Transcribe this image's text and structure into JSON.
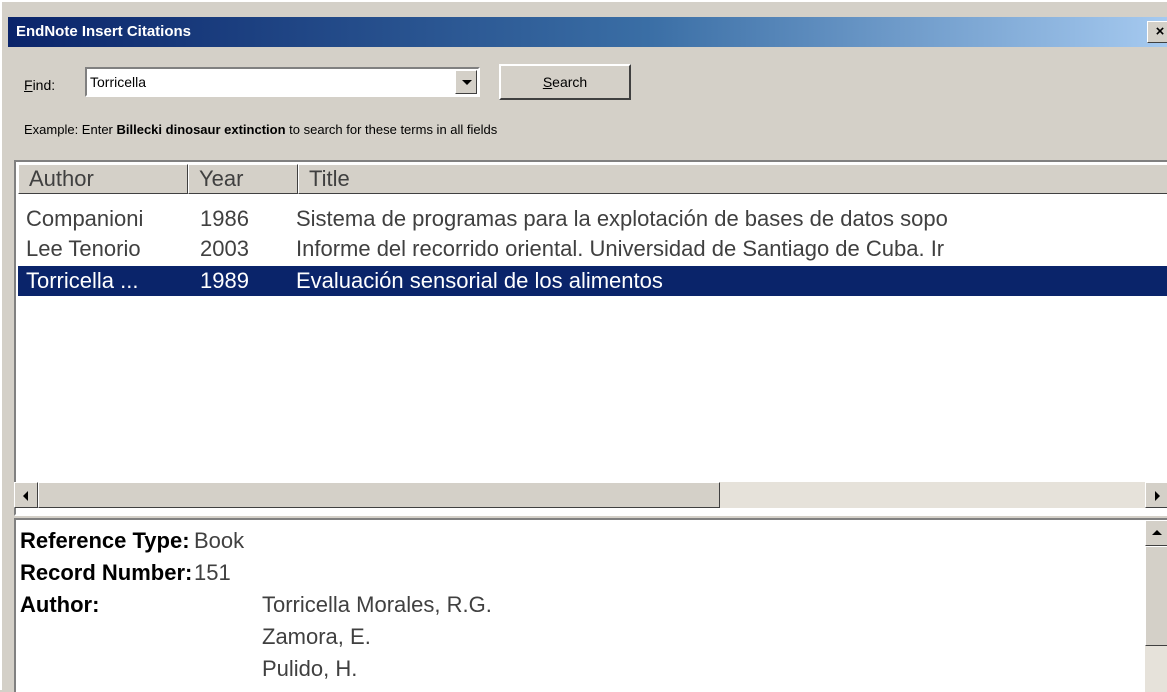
{
  "window": {
    "title": "EndNote Insert Citations",
    "close_label": "×"
  },
  "find": {
    "label_accel": "F",
    "label_rest": "ind:",
    "value": "Torricella",
    "search_accel": "S",
    "search_rest": "earch"
  },
  "example": {
    "prefix": "Example: Enter ",
    "terms": "Billecki dinosaur extinction",
    "suffix": " to search for these terms in all fields"
  },
  "list": {
    "columns": [
      "Author",
      "Year",
      "Title"
    ],
    "rows": [
      {
        "author": "Companioni",
        "year": "1986",
        "title": "Sistema de programas para la explotación de bases de datos sopo",
        "selected": false
      },
      {
        "author": "Lee Tenorio",
        "year": "2003",
        "title": "Informe del recorrido oriental. Universidad de Santiago de Cuba. Ir",
        "selected": false
      },
      {
        "author": "Torricella ...",
        "year": "1989",
        "title": "Evaluación sensorial de los alimentos",
        "selected": true
      }
    ]
  },
  "detail": {
    "reference_type_label": "Reference Type:",
    "reference_type_value": "Book",
    "record_number_label": "Record Number:",
    "record_number_value": "151",
    "author_label": "Author:",
    "authors": [
      "Torricella Morales, R.G.",
      "Zamora, E.",
      "Pulido, H."
    ]
  }
}
